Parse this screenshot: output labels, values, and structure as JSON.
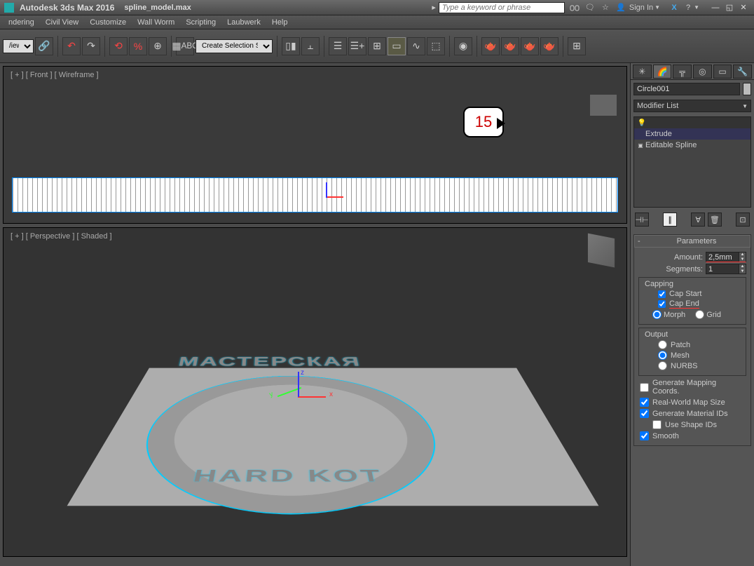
{
  "titlebar": {
    "app_title": "Autodesk 3ds Max 2016",
    "file_name": "spline_model.max",
    "search_placeholder": "Type a keyword or phrase",
    "sign_in": "Sign In"
  },
  "menubar": {
    "items": [
      "ndering",
      "Civil View",
      "Customize",
      "Wall Worm",
      "Scripting",
      "Laubwerk",
      "Help"
    ]
  },
  "toolbar": {
    "view_dropdown": "/iew",
    "selection_dropdown": "Create Selection Se"
  },
  "viewports": {
    "top_label": "[ + ] [ Front ] [ Wireframe ]",
    "bottom_label": "[ + ] [ Perspective ] [ Shaded ]",
    "coin_text_top": "МАСТЕРСКАЯ",
    "coin_text_bottom": "HARD KOT"
  },
  "callout": {
    "number": "15"
  },
  "right_panel": {
    "object_name": "Circle001",
    "modifier_list_label": "Modifier List",
    "stack": {
      "items": [
        {
          "icon": "💡",
          "label": "Extrude",
          "selected": true,
          "expandable": false
        },
        {
          "icon": "▣",
          "label": "Editable Spline",
          "selected": false,
          "expandable": true
        }
      ]
    },
    "parameters": {
      "header": "Parameters",
      "amount_label": "Amount:",
      "amount_value": "2,5mm",
      "segments_label": "Segments:",
      "segments_value": "1",
      "capping_label": "Capping",
      "cap_start": "Cap Start",
      "cap_end": "Cap End",
      "morph": "Morph",
      "grid": "Grid",
      "output_label": "Output",
      "patch": "Patch",
      "mesh": "Mesh",
      "nurbs": "NURBS",
      "gen_mapping": "Generate Mapping Coords.",
      "real_world": "Real-World Map Size",
      "gen_material": "Generate Material IDs",
      "use_shape": "Use Shape IDs",
      "smooth": "Smooth"
    }
  }
}
